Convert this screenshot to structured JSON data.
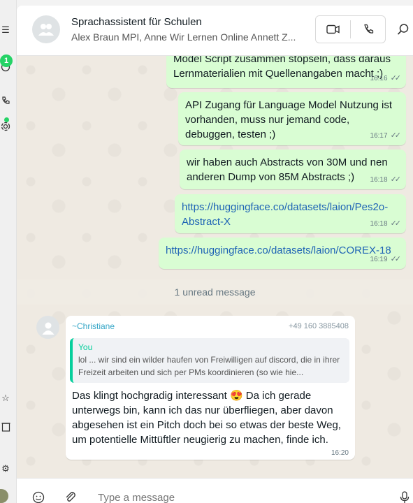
{
  "rail": {
    "badge_count": "1"
  },
  "header": {
    "title": "Sprachassistent für Schulen",
    "participants": "Alex Braun MPI, Anne Wir Lernen Online Annett Z..."
  },
  "messages_out": [
    {
      "text": "Model Script zusammen stöpseln, dass daraus Lernmaterialien mit Quellenangaben macht ;)",
      "time": "16:16"
    },
    {
      "text": "API Zugang für Language Model Nutzung ist vorhanden, muss nur jemand code, debuggen, testen ;)",
      "time": "16:17"
    },
    {
      "text": "wir haben auch Abstracts von 30M und nen anderen Dump von 85M Abstracts ;)",
      "time": "16:18"
    },
    {
      "text": "https://huggingface.co/datasets/laion/Pes2o-Abstract-X",
      "time": "16:18"
    },
    {
      "text": "https://huggingface.co/datasets/laion/COREX-18",
      "time": "16:19"
    }
  ],
  "unread_label": "1 unread message",
  "incoming": {
    "sender": "~Christiane",
    "phone": "+49 160 3885408",
    "quote_author": "You",
    "quote_text": "lol ... wir sind ein wilder haufen von Freiwilligen auf discord, die in ihrer Freizeit arbeiten und sich per PMs koordinieren (so wie hie...",
    "text": "Das klingt hochgradig interessant 😍 Da ich gerade unterwegs bin, kann ich das nur überfliegen, aber davon abgesehen ist ein Pitch doch bei so etwas der beste Weg, um potentielle Mittüftler neugierig zu machen, finde ich.",
    "time": "16:20"
  },
  "composer": {
    "placeholder": "Type a message"
  },
  "colors": {
    "outgoing_bubble": "#d9fdd3",
    "chat_bg": "#efeae2",
    "accent": "#25d366",
    "link": "#1e63b5",
    "sender": "#35a6c7"
  }
}
